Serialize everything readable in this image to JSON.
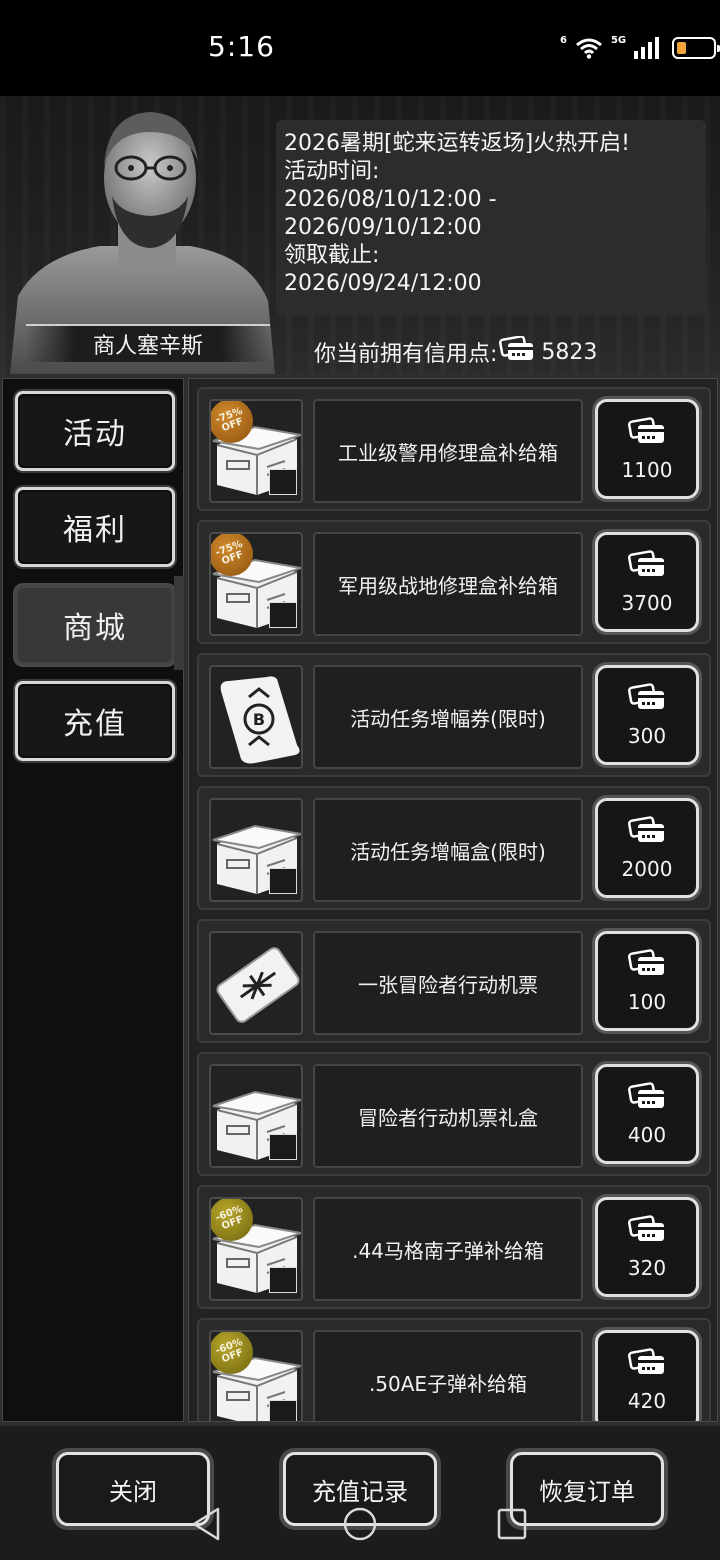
{
  "status_bar": {
    "time": "5:16",
    "net_label": "5G",
    "wifi_label": "6"
  },
  "header": {
    "merchant_name": "商人塞辛斯",
    "announcement_lines": [
      "2026暑期[蛇来运转返场]火热开启!",
      "活动时间:",
      "2026/08/10/12:00 -",
      "2026/09/10/12:00",
      "领取截止:",
      "2026/09/24/12:00"
    ],
    "credits_label": "你当前拥有信用点:",
    "credits_value": "5823"
  },
  "sidebar": {
    "tabs": [
      {
        "label": "活动",
        "active": false
      },
      {
        "label": "福利",
        "active": false
      },
      {
        "label": "商城",
        "active": true
      },
      {
        "label": "充值",
        "active": false
      }
    ]
  },
  "shop_items": [
    {
      "name": "工业级警用修理盒补给箱",
      "price": "1100",
      "badge": "-75%\nOFF",
      "badge_color": "#a96a1c",
      "icon": "supply-crate-icon"
    },
    {
      "name": "军用级战地修理盒补给箱",
      "price": "3700",
      "badge": "-75%\nOFF",
      "badge_color": "#a96a1c",
      "icon": "supply-crate-icon"
    },
    {
      "name": "活动任务增幅券(限时)",
      "price": "300",
      "badge": "",
      "badge_color": "",
      "icon": "scroll-coupon-icon"
    },
    {
      "name": "活动任务增幅盒(限时)",
      "price": "2000",
      "badge": "",
      "badge_color": "",
      "icon": "supply-crate-icon"
    },
    {
      "name": "一张冒险者行动机票",
      "price": "100",
      "badge": "",
      "badge_color": "",
      "icon": "ticket-icon"
    },
    {
      "name": "冒险者行动机票礼盒",
      "price": "400",
      "badge": "",
      "badge_color": "",
      "icon": "supply-crate-icon"
    },
    {
      "name": ".44马格南子弹补给箱",
      "price": "320",
      "badge": "-60%\nOFF",
      "badge_color": "#8f8318",
      "icon": "supply-crate-icon"
    },
    {
      "name": ".50AE子弹补给箱",
      "price": "420",
      "badge": "-60%\nOFF",
      "badge_color": "#8f8318",
      "icon": "supply-crate-icon"
    }
  ],
  "footer": {
    "close_label": "关闭",
    "recharge_record_label": "充值记录",
    "restore_order_label": "恢复订单"
  }
}
